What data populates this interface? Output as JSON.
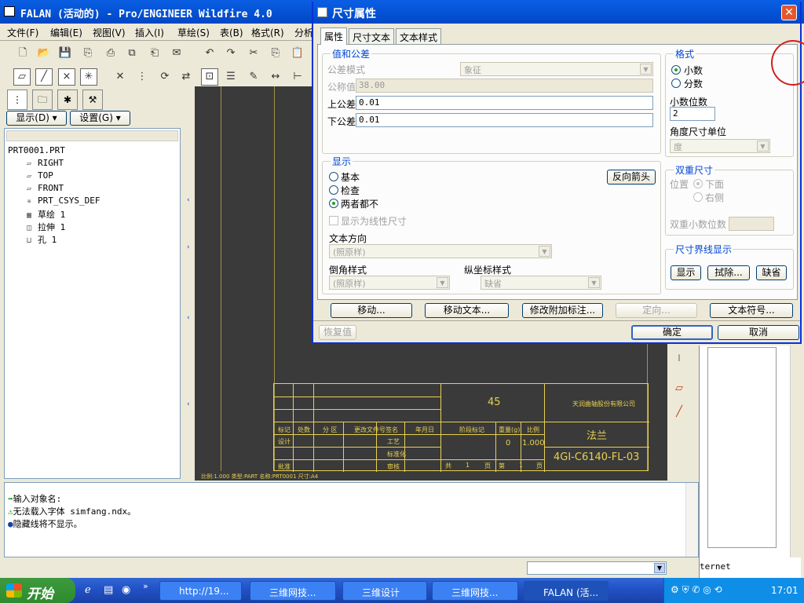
{
  "main_window": {
    "title": "FALAN (活动的) - Pro/ENGINEER Wildfire 4.0",
    "menu": [
      "文件(F)",
      "编辑(E)",
      "视图(V)",
      "插入(I)",
      "草绘(S)",
      "表(B)",
      "格式(R)",
      "分析"
    ]
  },
  "nav": {
    "show_button": "显示(D) ▾",
    "settings_button": "设置(G) ▾",
    "tree": [
      {
        "label": "PRT0001.PRT",
        "icon": "part-icon"
      },
      {
        "label": "RIGHT",
        "icon": "datum-plane-icon"
      },
      {
        "label": "TOP",
        "icon": "datum-plane-icon"
      },
      {
        "label": "FRONT",
        "icon": "datum-plane-icon"
      },
      {
        "label": "PRT_CSYS_DEF",
        "icon": "csys-icon"
      },
      {
        "label": "草绘 1",
        "icon": "sketch-icon"
      },
      {
        "label": "拉伸 1",
        "icon": "extrude-icon"
      },
      {
        "label": "孔 1",
        "icon": "hole-icon"
      }
    ]
  },
  "drawing": {
    "titleblock": {
      "material": "45",
      "company": "天润曲轴股份有限公司",
      "part_name": "法兰",
      "drawing_no": "4GI-C6140-FL-03",
      "scale_value": "1.000",
      "weight_value": "0",
      "headers": [
        "标记",
        "处数",
        "分 区",
        "更改文件号",
        "签名",
        "年月日"
      ],
      "row_labels": [
        "设计",
        "标准化",
        "审核",
        "批准"
      ],
      "mid_labels": [
        "工艺",
        "阶段标记",
        "重量(g)",
        "比例"
      ],
      "sheet_left": "共",
      "sheet_count": "1",
      "sheet_page_label": "页",
      "sheet_no_label": "第",
      "sheet_no": "1",
      "sheet_page_label2": "页",
      "bottom_text": "比例:1.000   类型:PART   名称:PRT0001   尺寸:A4"
    }
  },
  "messages": [
    {
      "icon": "arrow-icon",
      "text": "输入对象名:"
    },
    {
      "icon": "warning-icon",
      "text": "无法载入字体 simfang.ndx。"
    },
    {
      "icon": "bullet-icon",
      "text": "隐藏线将不显示。"
    }
  ],
  "browser_partial_text": "ternet",
  "dialog": {
    "title": "尺寸属性",
    "tabs": [
      "属性",
      "尺寸文本",
      "文本样式"
    ],
    "active_tab": "属性",
    "value_tolerance": {
      "group_title": "值和公差",
      "tol_mode_label": "公差模式",
      "tol_mode_value": "象征",
      "nominal_label": "公称值",
      "nominal_value": "38.00",
      "upper_label": "上公差",
      "upper_value": "0.01",
      "lower_label": "下公差",
      "lower_value": "0.01"
    },
    "format": {
      "group_title": "格式",
      "decimal_label": "小数",
      "fraction_label": "分数",
      "selected": "小数",
      "decimals_label": "小数位数",
      "decimals_value": "2",
      "angle_unit_label": "角度尺寸单位",
      "angle_unit_value": "度"
    },
    "display": {
      "group_title": "显示",
      "basic_label": "基本",
      "inspect_label": "检查",
      "neither_label": "两者都不",
      "selected": "两者都不",
      "flip_arrows_button": "反向箭头",
      "linear_checkbox_label": "显示为线性尺寸",
      "text_orient_label": "文本方向",
      "text_orient_value": "(照原样)",
      "chamfer_label": "倒角样式",
      "chamfer_value": "(照原样)",
      "ordinate_label": "纵坐标样式",
      "ordinate_value": "缺省"
    },
    "dual": {
      "group_title": "双重尺寸",
      "position_label": "位置",
      "below_label": "下面",
      "right_label": "右侧",
      "dual_decimals_label": "双重小数位数"
    },
    "witness": {
      "group_title": "尺寸界线显示",
      "show_button": "显示",
      "erase_button": "拭除...",
      "default_button": "缺省"
    },
    "bottom_buttons": [
      "移动...",
      "移动文本...",
      "修改附加标注...",
      "定向...",
      "文本符号..."
    ],
    "restore_button": "恢复值",
    "ok_button": "确定",
    "cancel_button": "取消"
  },
  "taskbar": {
    "start_label": "开始",
    "tasks": [
      "http://19...",
      "三维网技...",
      "三维设计",
      "三维网技...",
      "FALAN (活..."
    ],
    "clock": "17:01"
  }
}
